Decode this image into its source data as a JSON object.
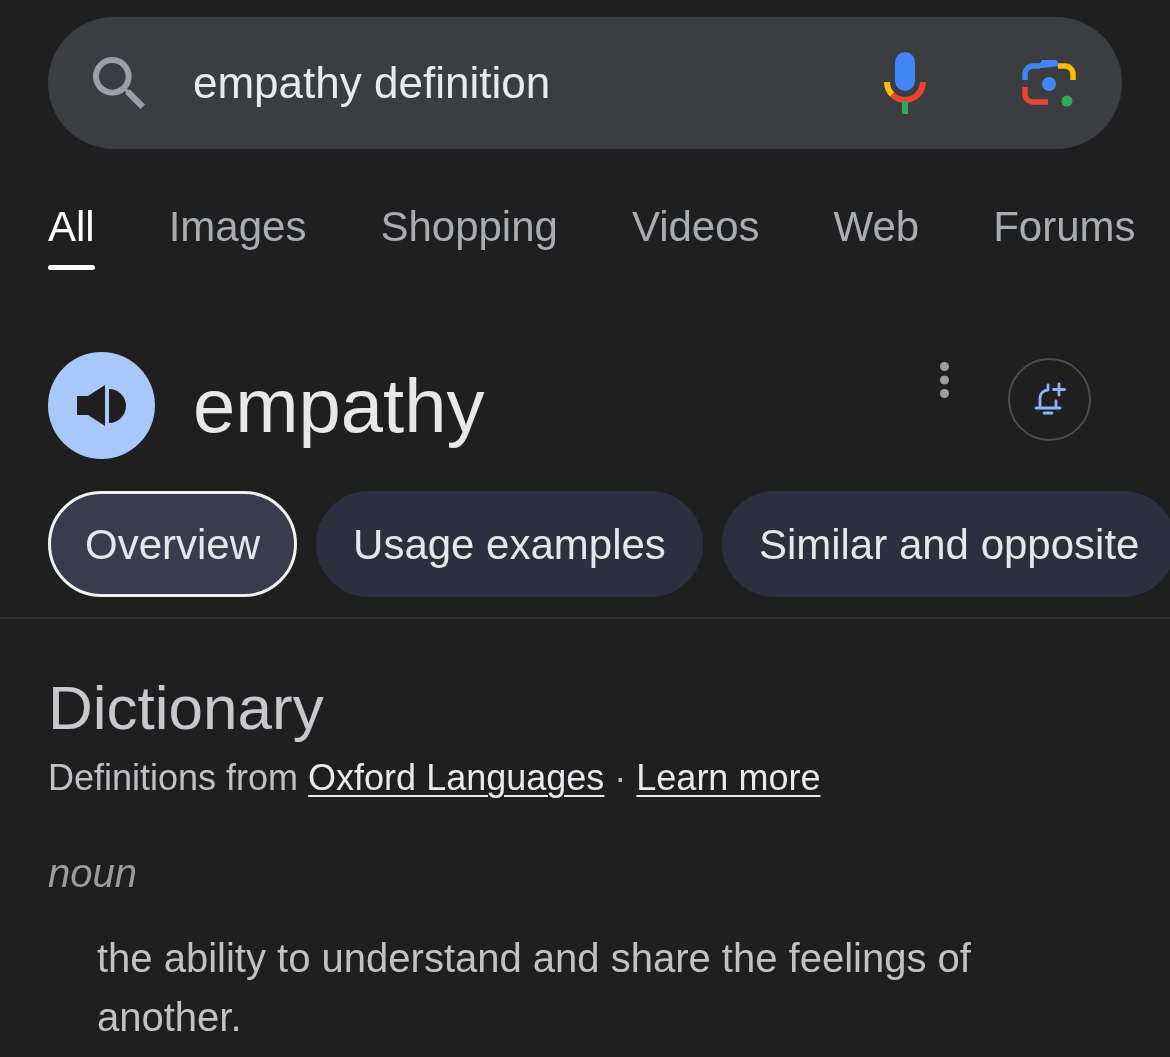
{
  "search": {
    "query": "empathy definition"
  },
  "tabs": [
    {
      "label": "All",
      "selected": true
    },
    {
      "label": "Images",
      "selected": false
    },
    {
      "label": "Shopping",
      "selected": false
    },
    {
      "label": "Videos",
      "selected": false
    },
    {
      "label": "Web",
      "selected": false
    },
    {
      "label": "Forums",
      "selected": false
    }
  ],
  "entry": {
    "word": "empathy"
  },
  "chips": [
    {
      "label": "Overview",
      "selected": true
    },
    {
      "label": "Usage examples",
      "selected": false
    },
    {
      "label": "Similar and opposite",
      "selected": false
    }
  ],
  "dictionary": {
    "title": "Dictionary",
    "attribution": {
      "text": "Definitions from",
      "source_link": "Oxford Languages",
      "separator": "·",
      "more_link": "Learn more"
    },
    "part_of_speech": "noun",
    "definitions": [
      "the ability to understand and share the feelings of another."
    ]
  }
}
